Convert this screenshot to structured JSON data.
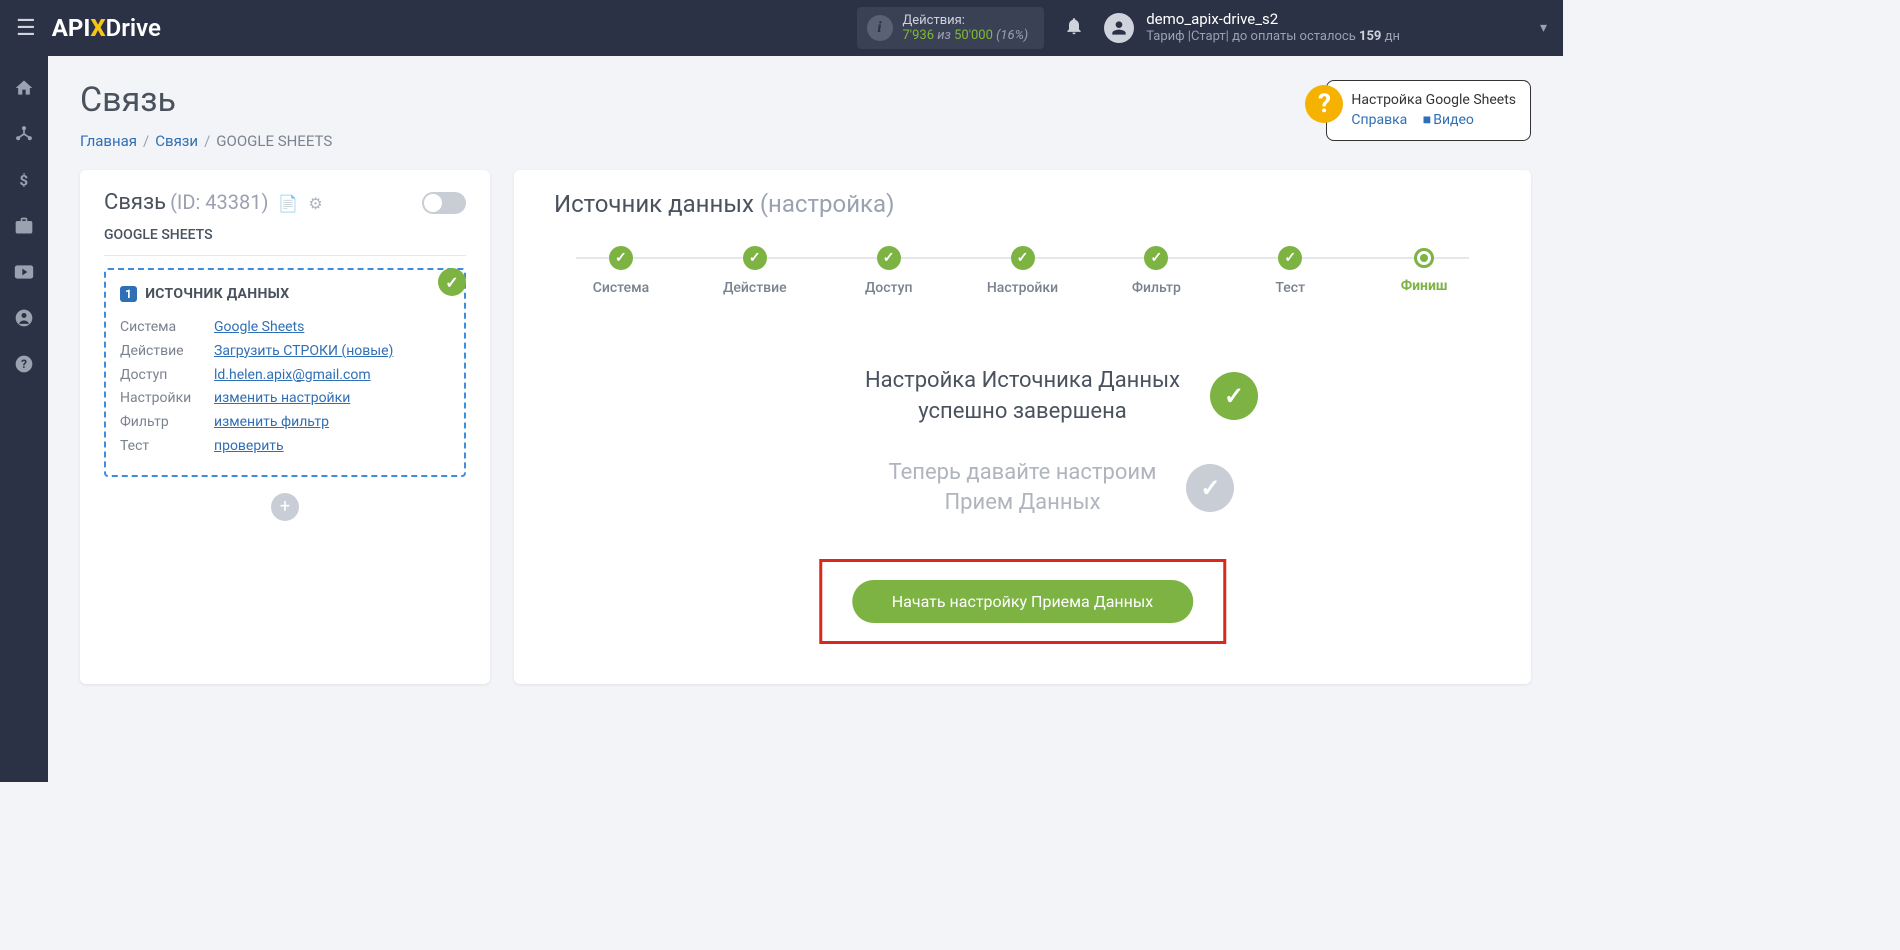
{
  "header": {
    "actions_label": "Действия:",
    "actions_used": "7'936",
    "actions_sep": " из ",
    "actions_total": "50'000",
    "actions_pct": " (16%)",
    "user_name": "demo_apix-drive_s2",
    "tariff_prefix": "Тариф |Старт| до оплаты осталось ",
    "tariff_days": "159",
    "tariff_suffix": " дн"
  },
  "page": {
    "title": "Связь",
    "bc_home": "Главная",
    "bc_conn": "Связи",
    "bc_current": "GOOGLE SHEETS"
  },
  "help": {
    "title": "Настройка Google Sheets",
    "link1": "Справка",
    "link2": "Видео"
  },
  "left": {
    "title": "Связь",
    "id_label": "(ID: 43381)",
    "subtitle": "GOOGLE SHEETS",
    "source_head": "ИСТОЧНИК ДАННЫХ",
    "num": "1",
    "rows": {
      "system_lbl": "Система",
      "system_val": "Google Sheets",
      "action_lbl": "Действие",
      "action_val": "Загрузить СТРОКИ (новые)",
      "access_lbl": "Доступ",
      "access_val": "ld.helen.apix@gmail.com",
      "settings_lbl": "Настройки",
      "settings_val": "изменить настройки",
      "filter_lbl": "Фильтр",
      "filter_val": "изменить фильтр",
      "test_lbl": "Тест",
      "test_val": "проверить"
    }
  },
  "right": {
    "title_main": "Источник данных",
    "title_sub": "(настройка)",
    "steps": [
      "Система",
      "Действие",
      "Доступ",
      "Настройки",
      "Фильтр",
      "Тест",
      "Финиш"
    ],
    "msg1_l1": "Настройка Источника Данных",
    "msg1_l2": "успешно завершена",
    "msg2_l1": "Теперь давайте настроим",
    "msg2_l2": "Прием Данных",
    "cta": "Начать настройку Приема Данных"
  }
}
